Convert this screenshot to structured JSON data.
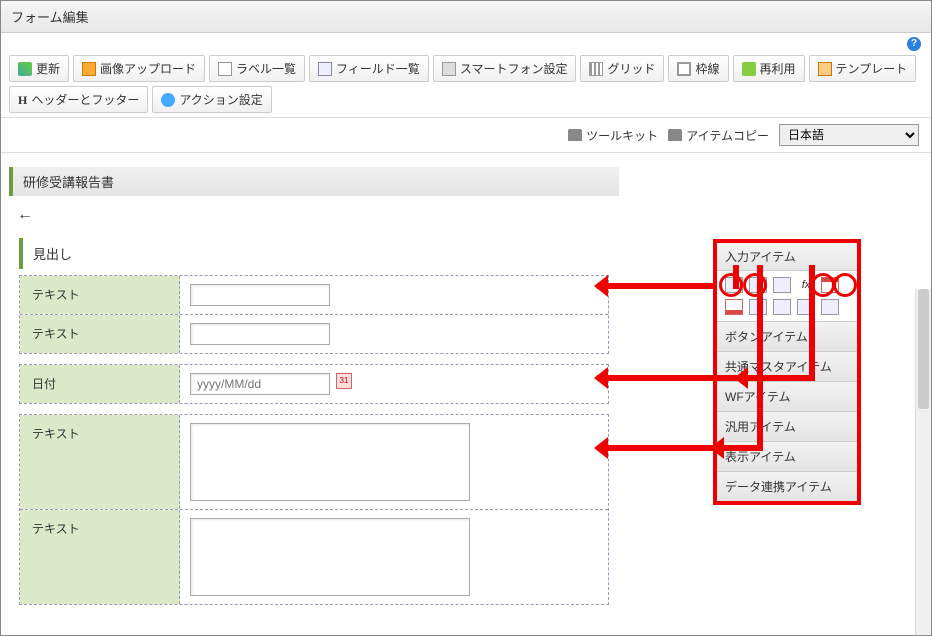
{
  "window": {
    "title": "フォーム編集"
  },
  "toolbar": {
    "refresh": "更新",
    "image_upload": "画像アップロード",
    "label_list": "ラベル一覧",
    "field_list": "フィールド一覧",
    "smartphone": "スマートフォン設定",
    "grid": "グリッド",
    "border": "枠線",
    "reuse": "再利用",
    "template": "テンプレート",
    "header_footer": "ヘッダーとフッター",
    "action_settings": "アクション設定"
  },
  "subtoolbar": {
    "toolkit": "ツールキット",
    "item_copy": "アイテムコピー",
    "language": "日本語"
  },
  "form": {
    "title": "研修受講報告書",
    "section_header": "見出し",
    "fields": [
      {
        "label": "テキスト",
        "type": "text",
        "value": ""
      },
      {
        "label": "テキスト",
        "type": "text",
        "value": ""
      },
      {
        "label": "日付",
        "type": "date",
        "placeholder": "yyyy/MM/dd"
      },
      {
        "label": "テキスト",
        "type": "textarea",
        "value": ""
      },
      {
        "label": "テキスト",
        "type": "textarea",
        "value": ""
      }
    ]
  },
  "palette": {
    "header": "入力アイテム",
    "fx_label": "fx",
    "categories": [
      "ボタンアイテム",
      "共通マスタアイテム",
      "WFアイテム",
      "汎用アイテム",
      "表示アイテム",
      "データ連携アイテム"
    ]
  },
  "cal_icon_text": "31"
}
